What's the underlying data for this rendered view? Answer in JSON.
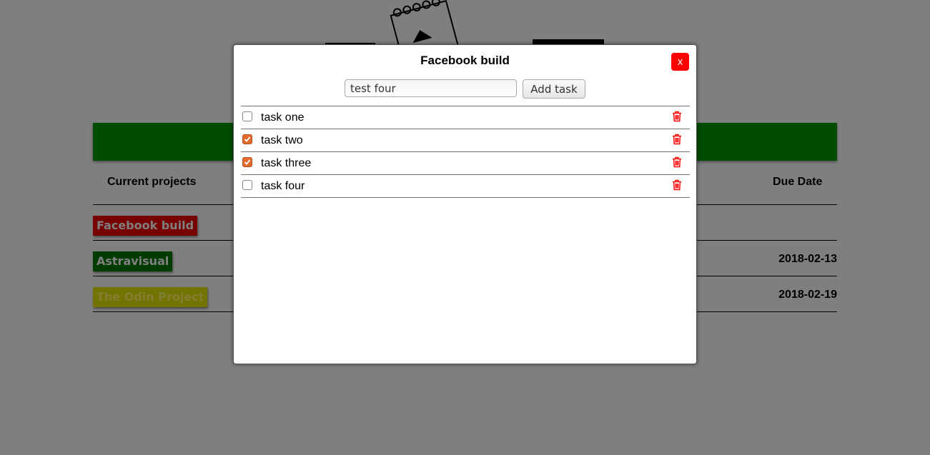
{
  "background": {
    "table": {
      "headers": {
        "projects": "Current projects",
        "due": "Due Date"
      },
      "rows": [
        {
          "name": "Facebook build",
          "color": "#ee0000",
          "due": ""
        },
        {
          "name": "Astravisual",
          "color": "#007700",
          "due": "2018-02-13"
        },
        {
          "name": "The Odin Project",
          "color": "#e6e600",
          "due": "2018-02-19"
        }
      ]
    },
    "banner_color": "#009900"
  },
  "modal": {
    "title": "Facebook build",
    "close_label": "x",
    "input": {
      "value": "test four",
      "placeholder": ""
    },
    "add_label": "Add task",
    "tasks": [
      {
        "label": "task one",
        "done": false
      },
      {
        "label": "task two",
        "done": true
      },
      {
        "label": "task three",
        "done": true
      },
      {
        "label": "task four",
        "done": false
      }
    ],
    "icons": {
      "delete": "trash-icon"
    },
    "colors": {
      "close": "#ff0000",
      "checked": "#e36b2e",
      "trash": "#ff0000"
    }
  }
}
